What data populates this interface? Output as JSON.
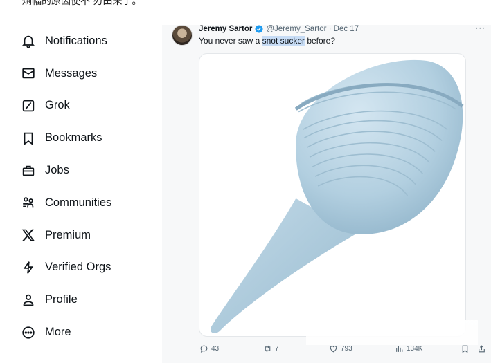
{
  "top_text": "熵幅的原因使不      刃田来了。",
  "sidebar": {
    "items": [
      {
        "label": "Notifications",
        "icon": "bell-icon"
      },
      {
        "label": "Messages",
        "icon": "envelope-icon"
      },
      {
        "label": "Grok",
        "icon": "grok-icon"
      },
      {
        "label": "Bookmarks",
        "icon": "bookmark-icon"
      },
      {
        "label": "Jobs",
        "icon": "briefcase-icon"
      },
      {
        "label": "Communities",
        "icon": "people-icon"
      },
      {
        "label": "Premium",
        "icon": "x-logo-icon"
      },
      {
        "label": "Verified Orgs",
        "icon": "lightning-icon"
      },
      {
        "label": "Profile",
        "icon": "person-icon"
      },
      {
        "label": "More",
        "icon": "more-circle-icon"
      }
    ]
  },
  "tweet": {
    "author": "Jeremy Sartor",
    "handle": "@Jeremy_Sartor · Dec 17",
    "text_before": "You never saw a ",
    "text_highlight": "snot sucker",
    "text_after": " before?",
    "menu": "···",
    "actions": {
      "replies": "43",
      "retweets": "7",
      "likes": "793",
      "views": "134K"
    }
  },
  "colors": {
    "verified": "#1d9bf0",
    "highlight": "#c7dcf5",
    "bulb": "#b4cfe0"
  }
}
